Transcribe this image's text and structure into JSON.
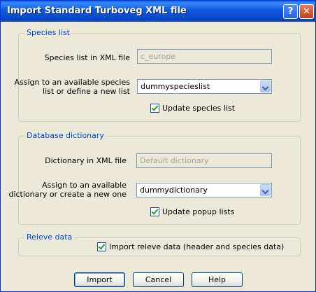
{
  "window": {
    "title": "Import Standard Turboveg XML file",
    "help_glyph": "?",
    "close_glyph": "✕"
  },
  "species": {
    "legend": "Species list",
    "xml_label": "Species list in XML file",
    "xml_value": "c_europe",
    "assign_label_line1": "Assign to an available species",
    "assign_label_line2": "list or define a new list",
    "assign_value": "dummyspecieslist",
    "update_label": "Update species list",
    "update_checked": true
  },
  "dictionary": {
    "legend": "Database dictionary",
    "xml_label": "Dictionary in XML file",
    "xml_value": "Default dictionary",
    "assign_label_line1": "Assign to an available",
    "assign_label_line2": "dictionary or create a new one",
    "assign_value": "dummydictionary",
    "update_label": "Update popup lists",
    "update_checked": true
  },
  "releve": {
    "legend": "Releve data",
    "import_label": "Import releve data (header and species data)",
    "import_checked": true
  },
  "buttons": {
    "import": "Import",
    "cancel": "Cancel",
    "help": "Help"
  },
  "colors": {
    "title_bar": "#0a5fe8",
    "legend_text": "#0046d5",
    "dialog_bg": "#ece9d8"
  }
}
